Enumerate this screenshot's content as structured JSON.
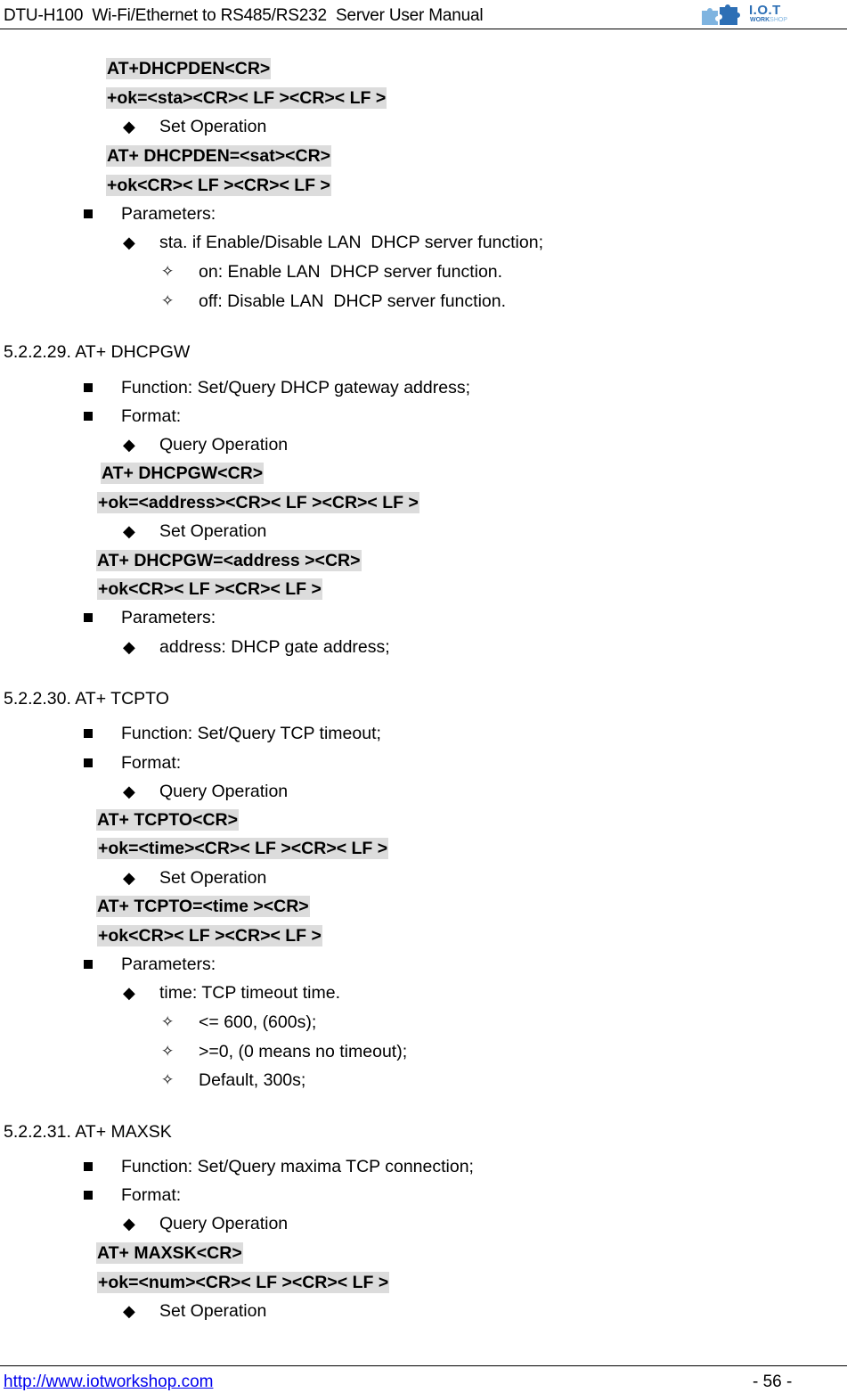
{
  "header": {
    "title": "DTU-H100  Wi-Fi/Ethernet to RS485/RS232  Server User Manual",
    "logo_text": "I.O.T",
    "logo_sub_a": "WORK",
    "logo_sub_b": "SHOP"
  },
  "footer": {
    "url": "http://www.iotworkshop.com",
    "page": "- 56 -"
  },
  "dhcpden": {
    "query_cmd": "AT+DHCPDEN<CR>",
    "query_resp": "+ok=<sta><CR>< LF ><CR>< LF >",
    "set_label": "Set Operation",
    "set_cmd": "AT+ DHCPDEN=<sat><CR>",
    "set_resp": "+ok<CR>< LF ><CR>< LF >",
    "params_label": "Parameters:",
    "param": "sta. if Enable/Disable LAN  DHCP server function;",
    "options": [
      "on: Enable LAN  DHCP server function.",
      "off: Disable LAN  DHCP server function."
    ]
  },
  "dhcpgw": {
    "heading": "5.2.2.29. AT+ DHCPGW",
    "function": "Function: Set/Query DHCP gateway address;",
    "format_label": "Format:",
    "query_label": "Query Operation",
    "query_cmd": "AT+ DHCPGW<CR>",
    "query_resp": "+ok=<address><CR>< LF ><CR>< LF >",
    "set_label": "Set Operation",
    "set_cmd": "AT+ DHCPGW=<address ><CR>",
    "set_resp": "+ok<CR>< LF ><CR>< LF >",
    "params_label": "Parameters:",
    "param": "address: DHCP gate address;"
  },
  "tcpto": {
    "heading": "5.2.2.30. AT+ TCPTO",
    "function": "Function: Set/Query TCP timeout;",
    "format_label": "Format:",
    "query_label": "Query Operation",
    "query_cmd": "AT+ TCPTO<CR>",
    "query_resp": "+ok=<time><CR>< LF ><CR>< LF >",
    "set_label": "Set Operation",
    "set_cmd": "AT+ TCPTO=<time ><CR>",
    "set_resp": "+ok<CR>< LF ><CR>< LF >",
    "params_label": "Parameters:",
    "param": "time: TCP timeout time.",
    "options": [
      "<= 600, (600s);",
      ">=0, (0 means no timeout);",
      "Default, 300s;"
    ]
  },
  "maxsk": {
    "heading": "5.2.2.31. AT+ MAXSK",
    "function": "Function: Set/Query maxima TCP connection;",
    "format_label": "Format:",
    "query_label": "Query Operation",
    "query_cmd": "AT+ MAXSK<CR>",
    "query_resp": "+ok=<num><CR>< LF ><CR>< LF >",
    "set_label": "Set Operation"
  },
  "icons": {
    "square_bullet": "■",
    "diamond_bullet": "◆",
    "star_bullet": "✧"
  }
}
